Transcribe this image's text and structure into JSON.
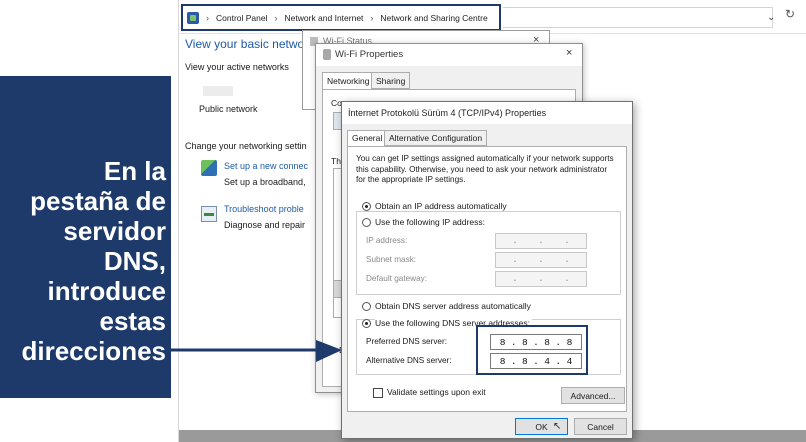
{
  "breadcrumb": {
    "items": [
      "Control Panel",
      "Network and Internet",
      "Network and Sharing Centre"
    ],
    "separator": "›"
  },
  "control_panel": {
    "title": "View your basic networ",
    "active_networks_label": "View your active networks",
    "network_type": "Public network",
    "change_settings_label": "Change your networking settin",
    "setup_link": "Set up a new connec",
    "setup_desc": "Set up a broadband,",
    "troubleshoot_link": "Troubleshoot proble",
    "troubleshoot_desc": "Diagnose and repair"
  },
  "wifi_status": {
    "title": "Wi-Fi Status",
    "close": "×"
  },
  "wifi_properties": {
    "title": "Wi-Fi Properties",
    "close": "×",
    "tabs": [
      "Networking",
      "Sharing"
    ],
    "connect_label": "Conn",
    "this_label": "Thi",
    "d_label": "D"
  },
  "ipv4_dialog": {
    "title": "İnternet Protokolü Sürüm 4 (TCP/IPv4) Properties",
    "tabs": [
      "General",
      "Alternative Configuration"
    ],
    "description": "You can get IP settings assigned automatically if your network supports this capability. Otherwise, you need to ask your network administrator for the appropriate IP settings.",
    "obtain_ip_auto": "Obtain an IP address automatically",
    "use_following_ip": "Use the following IP address:",
    "ip_address_label": "IP address:",
    "subnet_label": "Subnet mask:",
    "gateway_label": "Default gateway:",
    "obtain_dns_auto": "Obtain DNS server address automatically",
    "use_following_dns": "Use the following DNS server addresses:",
    "preferred_dns_label": "Preferred DNS server:",
    "alternative_dns_label": "Alternative DNS server:",
    "preferred_dns_octets": [
      "8",
      "8",
      "8",
      "8"
    ],
    "alternative_dns_octets": [
      "8",
      "8",
      "4",
      "4"
    ],
    "validate_label": "Validate settings upon exit",
    "advanced_button": "Advanced...",
    "ok_button": "OK",
    "cancel_button": "Cancel",
    "ip_selected": "auto",
    "dns_selected": "manual"
  },
  "callout": {
    "text": "En la pestaña de servidor DNS, introduce estas direcciones",
    "background": "#1d3a6b",
    "color": "#ffffff"
  },
  "colors": {
    "accent": "#1d3a6b",
    "link": "#1e5aa8"
  }
}
